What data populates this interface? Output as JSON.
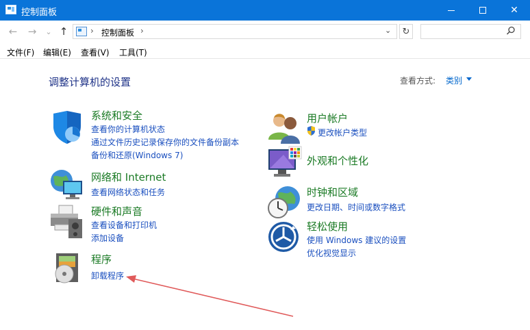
{
  "window": {
    "title": "控制面板",
    "controls": {
      "minimize": "minimize-icon",
      "maximize": "maximize-icon",
      "close": "✕"
    }
  },
  "address_bar": {
    "back_icon": "←",
    "forward_icon": "→",
    "recent_icon": "⌄",
    "up_icon": "↑",
    "breadcrumb": [
      "控制面板"
    ],
    "separator": "›",
    "dropdown_icon": "⌄",
    "refresh_icon": "↻",
    "search_placeholder": ""
  },
  "menu": {
    "items": [
      "文件(F)",
      "编辑(E)",
      "查看(V)",
      "工具(T)"
    ]
  },
  "main": {
    "heading": "调整计算机的设置",
    "view_by_label": "查看方式:",
    "view_by_value": "类别"
  },
  "categories_left": [
    {
      "title": "系统和安全",
      "links": [
        "查看你的计算机状态",
        "通过文件历史记录保存你的文件备份副本",
        "备份和还原(Windows 7)"
      ],
      "icon": "shield-icon"
    },
    {
      "title": "网络和 Internet",
      "links": [
        "查看网络状态和任务"
      ],
      "icon": "network-globe-icon"
    },
    {
      "title": "硬件和声音",
      "links": [
        "查看设备和打印机",
        "添加设备"
      ],
      "icon": "printer-icon"
    },
    {
      "title": "程序",
      "links": [
        "卸载程序"
      ],
      "icon": "programs-disc-icon"
    }
  ],
  "categories_right": [
    {
      "title": "用户帐户",
      "links": [
        "更改帐户类型"
      ],
      "icon": "users-icon",
      "link_icon": "uac-shield-icon"
    },
    {
      "title": "外观和个性化",
      "links": [],
      "icon": "monitor-palette-icon"
    },
    {
      "title": "时钟和区域",
      "links": [
        "更改日期、时间或数字格式"
      ],
      "icon": "clock-globe-icon"
    },
    {
      "title": "轻松使用",
      "links": [
        "使用 Windows 建议的设置",
        "优化视觉显示"
      ],
      "icon": "ease-of-access-icon"
    }
  ],
  "annotation": {
    "color": "#e05a5a",
    "icon": "red-arrow-annotation"
  },
  "colors": {
    "titlebar": "#0a74d9",
    "category_title": "#1a7a24",
    "link": "#1a4fbf",
    "heading": "#1e3287"
  }
}
